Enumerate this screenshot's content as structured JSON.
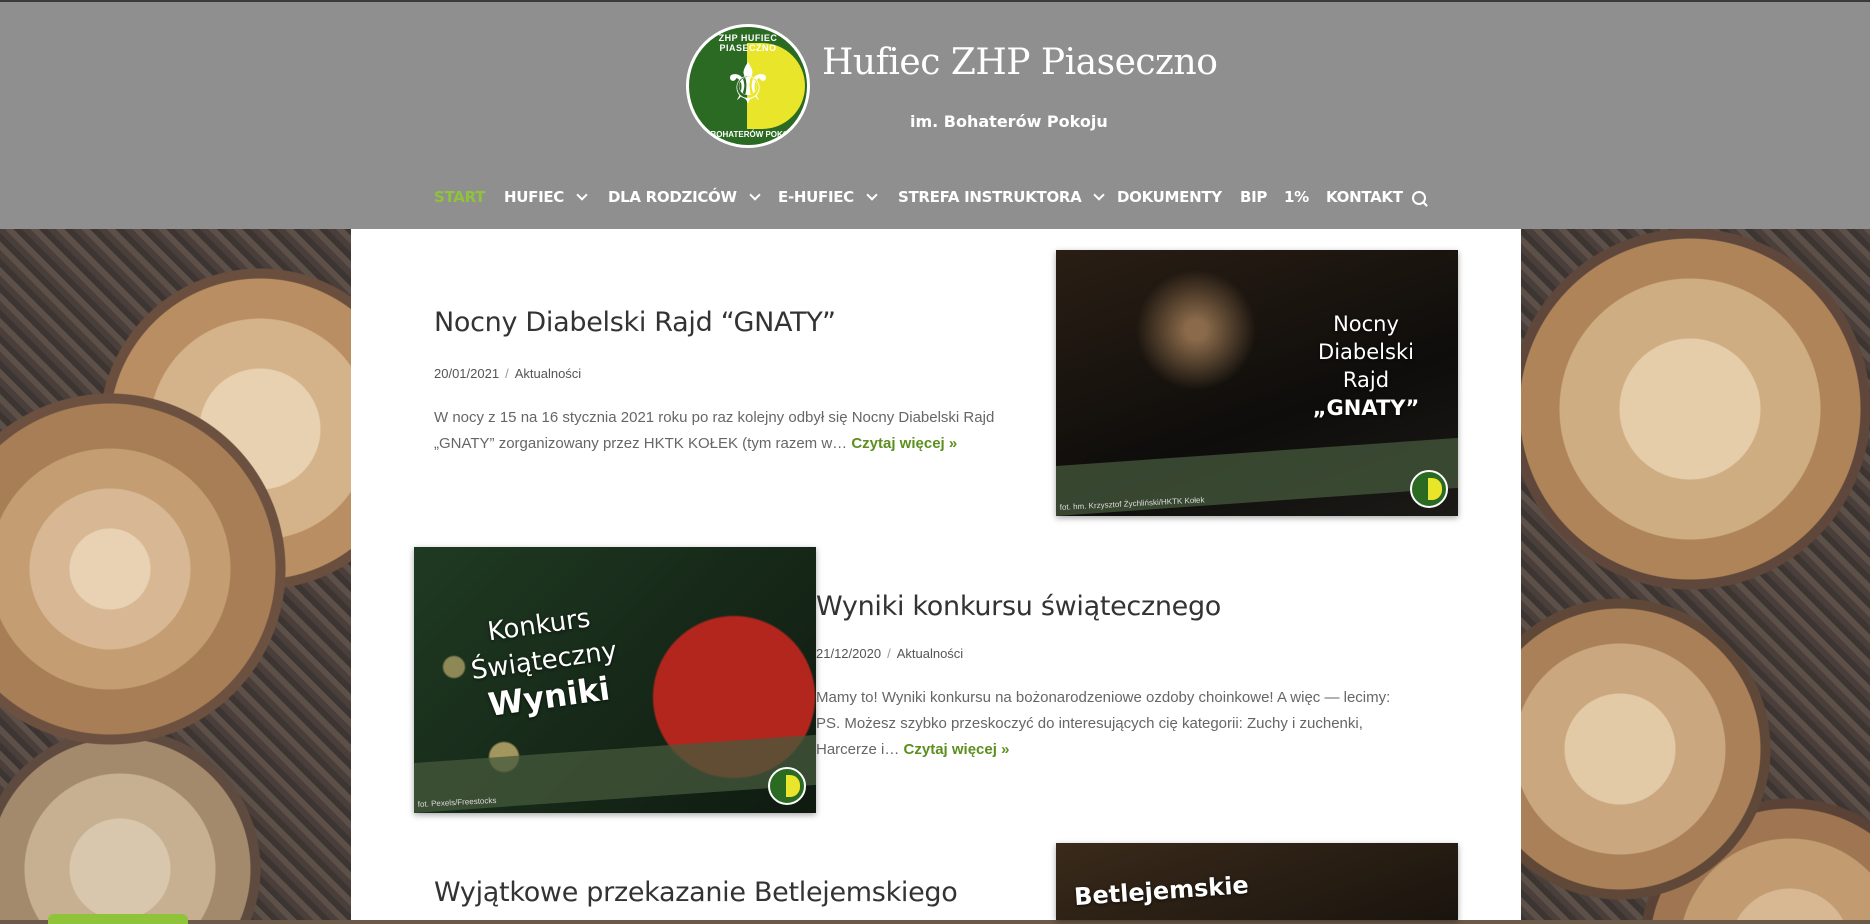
{
  "site": {
    "title": "Hufiec ZHP Piaseczno",
    "subtitle": "im. Bohaterów Pokoju",
    "logo_text_top": "ZHP HUFIEC PIASECZNO",
    "logo_text_bottom": "im. BOHATERÓW POKOJU"
  },
  "nav": {
    "items": [
      {
        "label": "START",
        "active": true
      },
      {
        "label": "HUFIEC",
        "dropdown": true
      },
      {
        "label": "DLA RODZICÓW",
        "dropdown": true
      },
      {
        "label": "E-HUFIEC",
        "dropdown": true
      },
      {
        "label": "STREFA INSTRUKTORA",
        "dropdown": true
      },
      {
        "label": "DOKUMENTY"
      },
      {
        "label": "BIP"
      },
      {
        "label": "1%"
      },
      {
        "label": "KONTAKT"
      }
    ],
    "search_icon": "search-icon"
  },
  "posts": [
    {
      "title": "Nocny Diabelski Rajd “GNATY”",
      "date": "20/01/2021",
      "category": "Aktualności",
      "excerpt": "W nocy z 15 na 16 stycznia 2021 roku po raz kolejny odbył się Nocny Diabelski Rajd „GNATY” zorganizowany przez HKTK KOŁEK (tym razem w…",
      "more": "Czytaj więcej »",
      "thumb_lines": [
        "Nocny",
        "Diabelski",
        "Rajd",
        "„GNATY”"
      ],
      "thumb_credit": "fot. hm. Krzysztof Żychliński/HKTK Kołek"
    },
    {
      "title": "Wyniki konkursu świątecznego",
      "date": "21/12/2020",
      "category": "Aktualności",
      "excerpt": "Mamy to! Wyniki konkursu na bożonarodzeniowe ozdoby choinkowe! A więc — lecimy: PS. Możesz szybko przeskoczyć do interesujących cię kategorii: Zuchy i zuchenki, Harcerze i…",
      "more": "Czytaj więcej »",
      "thumb_lines": [
        "Konkurs",
        "Świąteczny",
        "Wyniki"
      ],
      "thumb_credit": "fot. Pexels/Freestocks"
    },
    {
      "title": "Wyjątkowe przekazanie Betlejemskiego",
      "thumb_lines": [
        "Betlejemskie"
      ]
    }
  ]
}
